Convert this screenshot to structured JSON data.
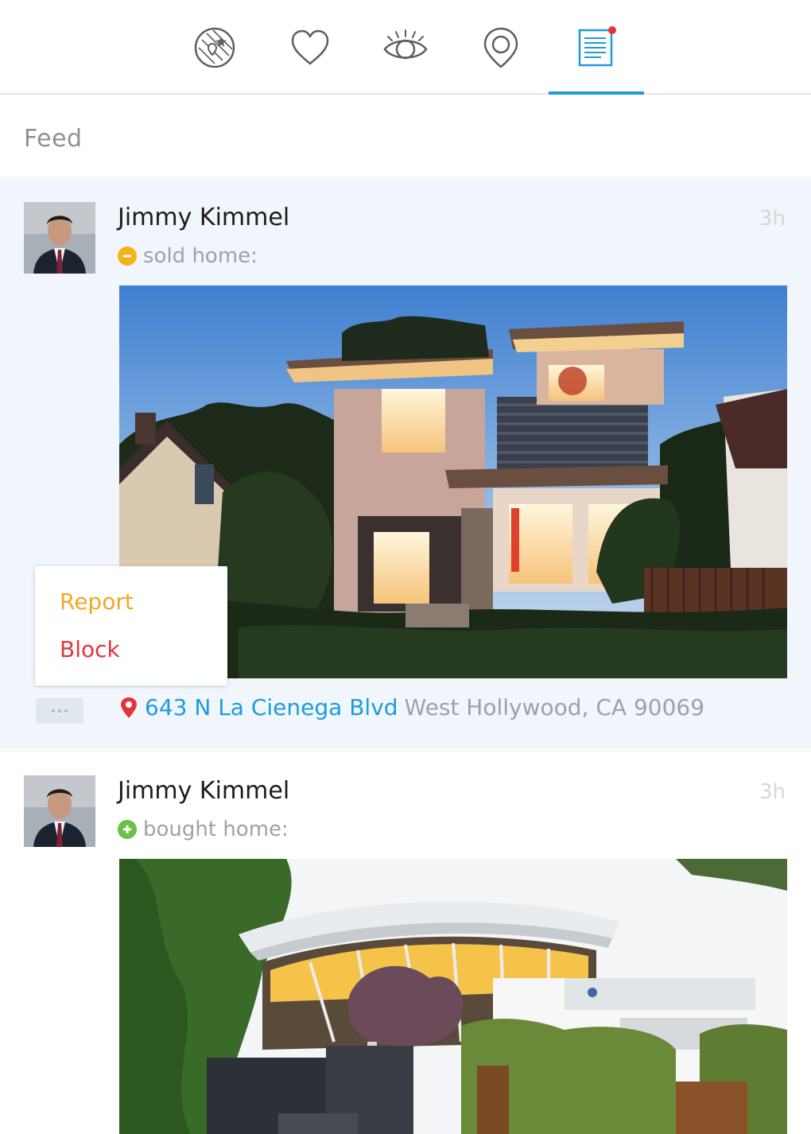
{
  "tabs": [
    {
      "icon": "explore-map-icon",
      "active": false
    },
    {
      "icon": "heart-icon",
      "active": false
    },
    {
      "icon": "eye-icon",
      "active": false
    },
    {
      "icon": "location-pin-icon",
      "active": false
    },
    {
      "icon": "feed-document-icon",
      "active": true,
      "has_notification": true
    }
  ],
  "colors": {
    "accent": "#1e9be0",
    "notification": "#e5333b",
    "sold": "#f5b21b",
    "bought": "#6cc04a",
    "report": "#f5a623",
    "block": "#e5333b",
    "highlight_bg": "#f0f6fc"
  },
  "section": {
    "title": "Feed"
  },
  "feed": [
    {
      "user": "Jimmy Kimmel",
      "time": "3h",
      "action": "sold home:",
      "action_type": "sold",
      "address": {
        "street": "643 N La Cienega Blvd",
        "city": "West Hollywood, CA  90069"
      }
    },
    {
      "user": "Jimmy Kimmel",
      "time": "3h",
      "action": "bought home:",
      "action_type": "bought"
    }
  ],
  "menu": {
    "report": "Report",
    "block": "Block"
  }
}
